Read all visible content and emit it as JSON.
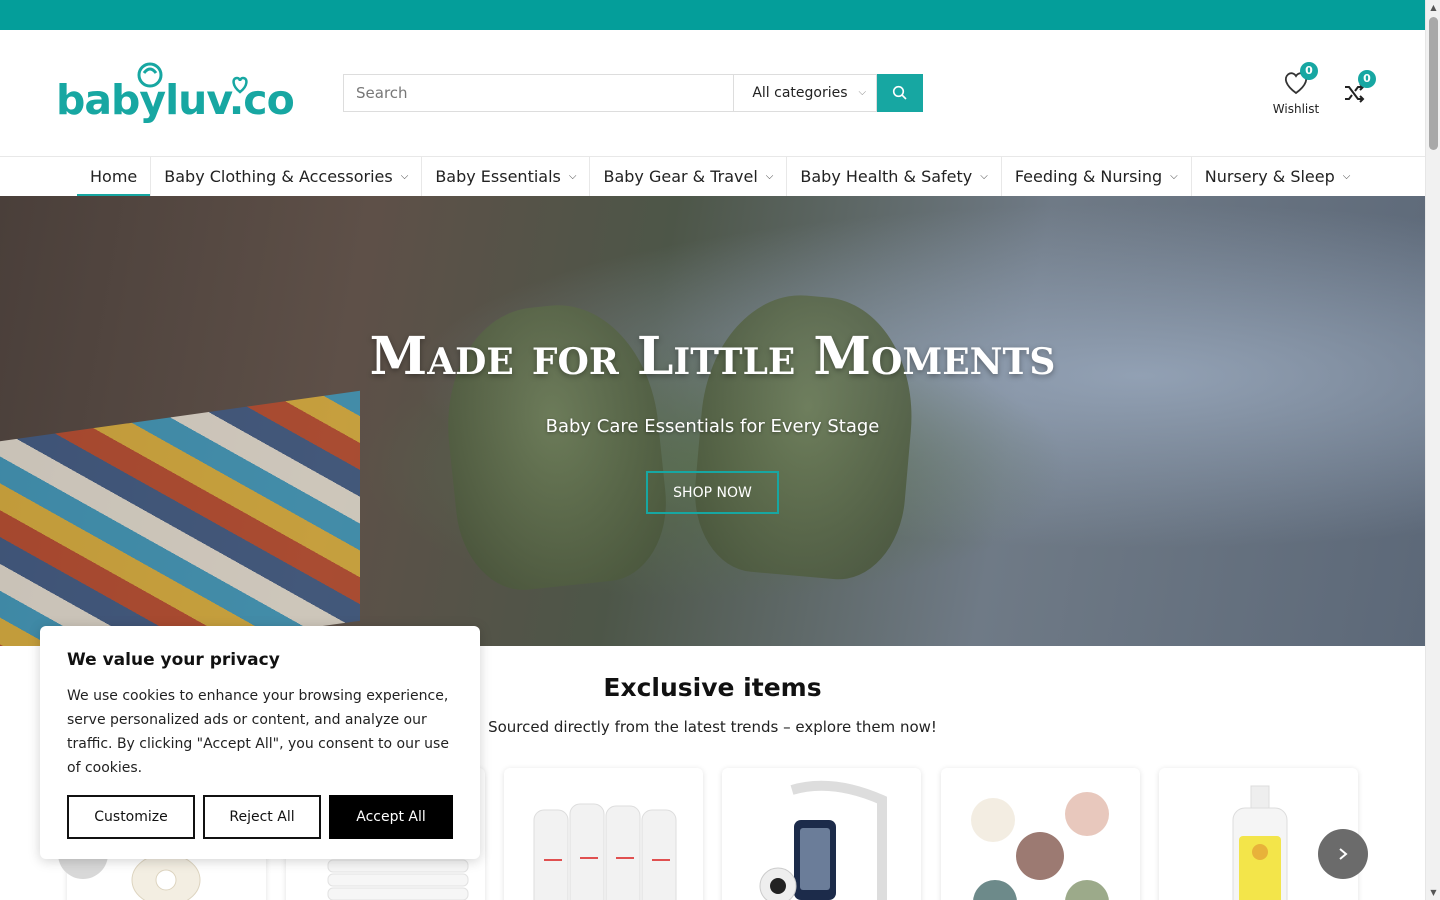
{
  "brand": {
    "logo_text": "babyluv.co",
    "accent_color": "#17a7a2",
    "topbar_color": "#049e9a"
  },
  "search": {
    "placeholder": "Search",
    "category_selected": "All categories"
  },
  "header": {
    "wishlist_label": "Wishlist",
    "wishlist_count": "0",
    "compare_count": "0"
  },
  "nav": {
    "items": [
      {
        "label": "Home",
        "active": true
      },
      {
        "label": "Baby Clothing & Accessories",
        "has_dropdown": true
      },
      {
        "label": "Baby Essentials",
        "has_dropdown": true
      },
      {
        "label": "Baby Gear & Travel",
        "has_dropdown": true
      },
      {
        "label": "Baby Health & Safety",
        "has_dropdown": true
      },
      {
        "label": "Feeding & Nursing",
        "has_dropdown": true
      },
      {
        "label": "Nursery & Sleep",
        "has_dropdown": true
      }
    ]
  },
  "hero": {
    "title": "Made for Little Moments",
    "subtitle": "Baby Care Essentials for Every Stage",
    "button_label": "SHOP NOW"
  },
  "exclusive": {
    "title": "Exclusive items",
    "subtitle": "Sourced directly from the latest trends – explore them now!",
    "products": [
      {
        "icon": "pacifier-icon"
      },
      {
        "icon": "folded-towels-icon"
      },
      {
        "icon": "baby-bottles-icon"
      },
      {
        "icon": "baby-monitor-icon"
      },
      {
        "icon": "pacifiers-set-icon"
      },
      {
        "icon": "lotion-bottle-icon"
      }
    ]
  },
  "cookie": {
    "title": "We value your privacy",
    "body": "We use cookies to enhance your browsing experience, serve personalized ads or content, and analyze our traffic. By clicking \"Accept All\", you consent to our use of cookies.",
    "customize_label": "Customize",
    "reject_label": "Reject All",
    "accept_label": "Accept All"
  }
}
